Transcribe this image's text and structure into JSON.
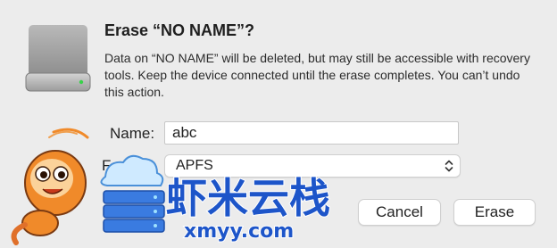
{
  "dialog": {
    "title": "Erase “NO NAME”?",
    "message": "Data on “NO NAME” will be deleted, but may still be accessible with recovery tools. Keep the device connected until the erase completes. You can’t undo this action."
  },
  "form": {
    "name_label": "Name:",
    "name_value": "abc",
    "format_label": "Format:",
    "format_value": "APFS"
  },
  "buttons": {
    "cancel": "Cancel",
    "erase": "Erase"
  },
  "watermark": {
    "logo_text": "虾米云栈",
    "logo_url_text": "xmyy.com",
    "icon": "shrimp-mascot-with-cloud-server"
  },
  "colors": {
    "dialog_background": "#ececec",
    "watermark_blue": "#1d55c9",
    "shrimp_orange": "#f08a2a"
  }
}
